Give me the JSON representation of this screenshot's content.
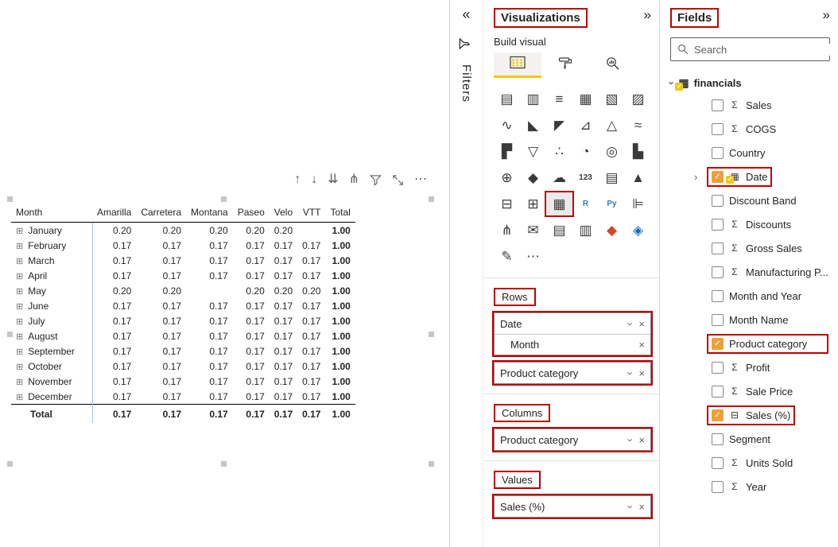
{
  "colors": {
    "annotation_red": "#C00000",
    "accent_yellow": "#F2C811",
    "checked_amber": "#E9A23B",
    "separator_blue": "#9CC3E4"
  },
  "icons": {
    "collapse": "«",
    "expand": "»",
    "chevron": "›",
    "close": "×",
    "checkmark": "✓",
    "row_expand": "⊞",
    "sigma": "Σ",
    "calendar": "▦",
    "calculator": "⊟",
    "table": "▦",
    "more": "⋯"
  },
  "filters_strip": {
    "label": "Filters"
  },
  "canvas": {
    "visual_toolbar": [
      {
        "name": "drill-up-icon",
        "glyph": "↑"
      },
      {
        "name": "drill-down-icon",
        "glyph": "↓"
      },
      {
        "name": "expand-all-down-icon",
        "glyph": "⇊"
      },
      {
        "name": "drill-mode-icon",
        "glyph": "⋔"
      },
      {
        "name": "filter-icon",
        "glyph": "svg-funnel"
      },
      {
        "name": "focus-mode-icon",
        "glyph": "svg-focus"
      },
      {
        "name": "more-options-icon",
        "glyph": "⋯"
      }
    ],
    "matrix": {
      "columns": [
        "Month",
        "Amarilla",
        "Carretera",
        "Montana",
        "Paseo",
        "Velo",
        "VTT",
        "Total"
      ],
      "rows": [
        {
          "label": "January",
          "values": [
            "0.20",
            "0.20",
            "0.20",
            "0.20",
            "0.20",
            "",
            "1.00"
          ]
        },
        {
          "label": "February",
          "values": [
            "0.17",
            "0.17",
            "0.17",
            "0.17",
            "0.17",
            "0.17",
            "1.00"
          ]
        },
        {
          "label": "March",
          "values": [
            "0.17",
            "0.17",
            "0.17",
            "0.17",
            "0.17",
            "0.17",
            "1.00"
          ]
        },
        {
          "label": "April",
          "values": [
            "0.17",
            "0.17",
            "0.17",
            "0.17",
            "0.17",
            "0.17",
            "1.00"
          ]
        },
        {
          "label": "May",
          "values": [
            "0.20",
            "0.20",
            "",
            "0.20",
            "0.20",
            "0.20",
            "1.00"
          ]
        },
        {
          "label": "June",
          "values": [
            "0.17",
            "0.17",
            "0.17",
            "0.17",
            "0.17",
            "0.17",
            "1.00"
          ]
        },
        {
          "label": "July",
          "values": [
            "0.17",
            "0.17",
            "0.17",
            "0.17",
            "0.17",
            "0.17",
            "1.00"
          ]
        },
        {
          "label": "August",
          "values": [
            "0.17",
            "0.17",
            "0.17",
            "0.17",
            "0.17",
            "0.17",
            "1.00"
          ]
        },
        {
          "label": "September",
          "values": [
            "0.17",
            "0.17",
            "0.17",
            "0.17",
            "0.17",
            "0.17",
            "1.00"
          ]
        },
        {
          "label": "October",
          "values": [
            "0.17",
            "0.17",
            "0.17",
            "0.17",
            "0.17",
            "0.17",
            "1.00"
          ]
        },
        {
          "label": "November",
          "values": [
            "0.17",
            "0.17",
            "0.17",
            "0.17",
            "0.17",
            "0.17",
            "1.00"
          ]
        },
        {
          "label": "December",
          "values": [
            "0.17",
            "0.17",
            "0.17",
            "0.17",
            "0.17",
            "0.17",
            "1.00"
          ]
        }
      ],
      "total": {
        "label": "Total",
        "values": [
          "0.17",
          "0.17",
          "0.17",
          "0.17",
          "0.17",
          "0.17",
          "1.00"
        ]
      }
    }
  },
  "visualizations": {
    "title": "Visualizations",
    "build_visual_label": "Build visual",
    "gallery": [
      {
        "name": "stacked-bar-chart",
        "glyph": "▤"
      },
      {
        "name": "stacked-column-chart",
        "glyph": "▥"
      },
      {
        "name": "clustered-bar-chart",
        "glyph": "≡"
      },
      {
        "name": "clustered-column-chart",
        "glyph": "▦"
      },
      {
        "name": "100-stacked-bar-chart",
        "glyph": "▧"
      },
      {
        "name": "100-stacked-column-chart",
        "glyph": "▨"
      },
      {
        "name": "line-chart",
        "glyph": "∿"
      },
      {
        "name": "area-chart",
        "glyph": "◣"
      },
      {
        "name": "stacked-area-chart",
        "glyph": "◤"
      },
      {
        "name": "line-and-stacked-column-chart",
        "glyph": "⊿"
      },
      {
        "name": "line-and-clustered-column-chart",
        "glyph": "△"
      },
      {
        "name": "ribbon-chart",
        "glyph": "≈"
      },
      {
        "name": "waterfall-chart",
        "glyph": "▛"
      },
      {
        "name": "funnel-chart",
        "glyph": "▽"
      },
      {
        "name": "scatter-chart",
        "glyph": "∴"
      },
      {
        "name": "pie-chart",
        "glyph": "◔"
      },
      {
        "name": "donut-chart",
        "glyph": "◎"
      },
      {
        "name": "treemap",
        "glyph": "▙"
      },
      {
        "name": "map",
        "glyph": "⊕"
      },
      {
        "name": "filled-map",
        "glyph": "◆"
      },
      {
        "name": "azure-map",
        "glyph": "☁"
      },
      {
        "name": "card",
        "glyph": "123",
        "small": true
      },
      {
        "name": "multi-row-card",
        "glyph": "▤"
      },
      {
        "name": "kpi",
        "glyph": "▲"
      },
      {
        "name": "slicer",
        "glyph": "⊟"
      },
      {
        "name": "table",
        "glyph": "⊞"
      },
      {
        "name": "matrix",
        "glyph": "▦",
        "selected": true,
        "boxed": true
      },
      {
        "name": "r-script-visual",
        "glyph": "R",
        "small": true,
        "color": "#2E7BBE"
      },
      {
        "name": "python-visual",
        "glyph": "Py",
        "small": true,
        "color": "#2E7BBE"
      },
      {
        "name": "key-influencers",
        "glyph": "⊫"
      },
      {
        "name": "decomposition-tree",
        "glyph": "⋔"
      },
      {
        "name": "qa",
        "glyph": "✉"
      },
      {
        "name": "smart-narrative",
        "glyph": "▤"
      },
      {
        "name": "paginated-report",
        "glyph": "▥"
      },
      {
        "name": "power-apps",
        "glyph": "◆",
        "color": "#D24726"
      },
      {
        "name": "metrics",
        "glyph": "◈",
        "color": "#0F6CBD"
      },
      {
        "name": "power-automate",
        "glyph": "✎"
      },
      {
        "name": "get-more-visuals",
        "glyph": "⋯"
      }
    ],
    "wells": {
      "rows_label": "Rows",
      "columns_label": "Columns",
      "values_label": "Values",
      "rows_groups": [
        {
          "fields": [
            {
              "label": "Date",
              "chevron": true
            },
            {
              "label": "Month",
              "child": true
            }
          ]
        },
        {
          "fields": [
            {
              "label": "Product category",
              "chevron": true
            }
          ]
        }
      ],
      "columns_groups": [
        {
          "fields": [
            {
              "label": "Product category",
              "chevron": true
            }
          ]
        }
      ],
      "values_groups": [
        {
          "fields": [
            {
              "label": "Sales (%)",
              "chevron": true
            }
          ]
        }
      ]
    }
  },
  "fields": {
    "title": "Fields",
    "search_placeholder": "Search",
    "table_name": "financials",
    "items": [
      {
        "label": "Sales",
        "icon": "sigma"
      },
      {
        "label": "COGS",
        "icon": "sigma"
      },
      {
        "label": "Country",
        "icon": "none"
      },
      {
        "label": "Date",
        "icon": "calendar",
        "checked": true,
        "expandable": true,
        "boxed": true
      },
      {
        "label": "Discount Band",
        "icon": "none"
      },
      {
        "label": "Discounts",
        "icon": "sigma"
      },
      {
        "label": "Gross Sales",
        "icon": "sigma"
      },
      {
        "label": "Manufacturing P...",
        "icon": "sigma"
      },
      {
        "label": "Month and Year",
        "icon": "none"
      },
      {
        "label": "Month Name",
        "icon": "none"
      },
      {
        "label": "Product category",
        "icon": "none",
        "checked": true,
        "boxed": true,
        "boxWide": true
      },
      {
        "label": "Profit",
        "icon": "sigma"
      },
      {
        "label": "Sale Price",
        "icon": "sigma"
      },
      {
        "label": "Sales (%)",
        "icon": "calculator",
        "checked": true,
        "boxed": true
      },
      {
        "label": "Segment",
        "icon": "none"
      },
      {
        "label": "Units Sold",
        "icon": "sigma"
      },
      {
        "label": "Year",
        "icon": "sigma"
      }
    ]
  }
}
